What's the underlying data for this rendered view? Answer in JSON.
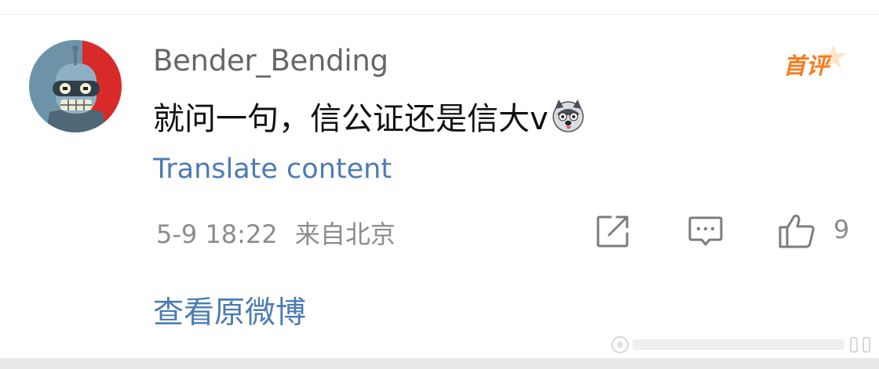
{
  "comment": {
    "username": "Bender_Bending",
    "badge": "首评",
    "text": "就问一句，信公证还是信大v",
    "translate_label": "Translate content",
    "timestamp": "5-9 18:22",
    "location": "来自北京",
    "like_count": "9",
    "emoji": "husky-dog-emoji",
    "avatar": "bender-robot-avatar"
  },
  "footer": {
    "view_original_label": "查看原微博"
  },
  "icons": [
    "share-icon",
    "comment-icon",
    "like-icon"
  ],
  "colors": {
    "link": "#4b7cb3",
    "badge": "#f57c1f",
    "meta": "#8c8c8c",
    "text": "#111111",
    "username": "#666666"
  }
}
